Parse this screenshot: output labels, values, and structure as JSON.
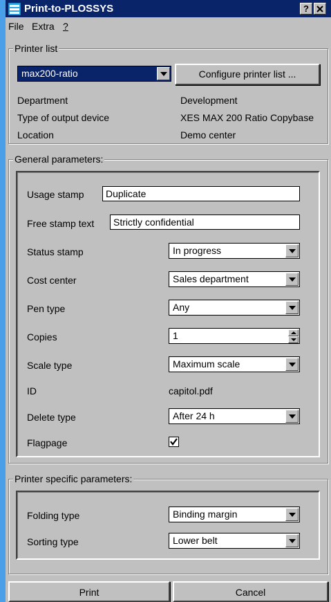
{
  "window": {
    "title": "Print-to-PLOSSYS",
    "help_button": "?",
    "close_button": "X"
  },
  "menu": {
    "file": "File",
    "extra": "Extra",
    "help": "?"
  },
  "printer_list": {
    "legend": "Printer list",
    "selected_printer": "max200-ratio",
    "configure_button": "Configure printer list ...",
    "rows": [
      {
        "label": "Department",
        "value": "Development"
      },
      {
        "label": "Type of output device",
        "value": "XES MAX 200 Ratio Copybase"
      },
      {
        "label": "Location",
        "value": "Demo center"
      }
    ]
  },
  "general": {
    "legend": "General parameters:",
    "usage_stamp": {
      "label": "Usage stamp",
      "value": "Duplicate"
    },
    "free_stamp_text": {
      "label": "Free stamp text",
      "value": "Strictly confidential"
    },
    "status_stamp": {
      "label": "Status stamp",
      "value": "In progress"
    },
    "cost_center": {
      "label": "Cost center",
      "value": "Sales department"
    },
    "pen_type": {
      "label": "Pen type",
      "value": "Any"
    },
    "copies": {
      "label": "Copies",
      "value": "1"
    },
    "scale_type": {
      "label": "Scale type",
      "value": "Maximum scale"
    },
    "id": {
      "label": "ID",
      "value": "capitol.pdf"
    },
    "delete_type": {
      "label": "Delete type",
      "value": "After 24 h"
    },
    "flagpage": {
      "label": "Flagpage",
      "checked": true
    }
  },
  "printer_specific": {
    "legend": "Printer specific parameters:",
    "folding_type": {
      "label": "Folding type",
      "value": "Binding margin"
    },
    "sorting_type": {
      "label": "Sorting type",
      "value": "Lower belt"
    }
  },
  "footer": {
    "print_button": "Print",
    "cancel_button": "Cancel"
  },
  "colors": {
    "titlebar": "#0a246a",
    "face": "#c0c0c0",
    "desktop": "#3a8fd8"
  }
}
